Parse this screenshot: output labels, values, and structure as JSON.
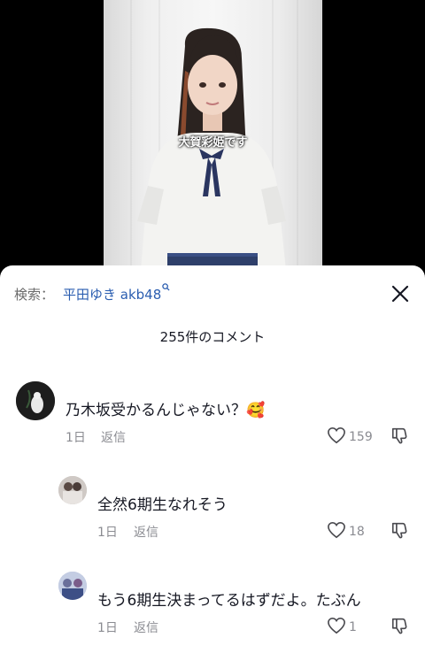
{
  "video": {
    "caption": "大賀彩姫です"
  },
  "sheet": {
    "search_prefix": "検索：",
    "search_query": "平田ゆき akb48",
    "comment_count": "255件のコメント"
  },
  "comments": [
    {
      "text": "乃木坂受かるんじゃない？🥰",
      "time": "1日",
      "reply": "返信",
      "likes": "159"
    },
    {
      "text": "全然6期生なれそう",
      "time": "1日",
      "reply": "返信",
      "likes": "18"
    },
    {
      "text": "もう6期生決まってるはずだよ。たぶん",
      "time": "1日",
      "reply": "返信",
      "likes": "1"
    }
  ],
  "colors": {
    "search_link": "#2a5db0",
    "meta_gray": "#8a8b91",
    "text": "#161823"
  }
}
